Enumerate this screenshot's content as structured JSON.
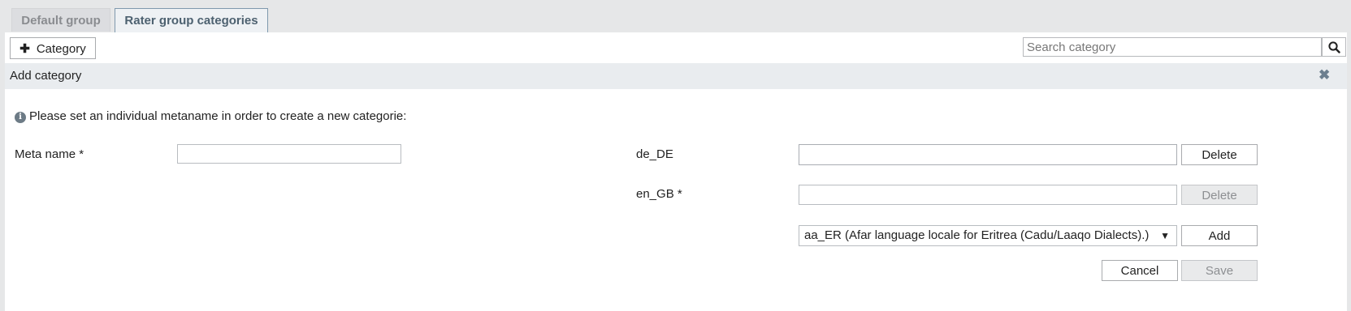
{
  "tabs": [
    {
      "label": "Default group"
    },
    {
      "label": "Rater group categories"
    }
  ],
  "toolbar": {
    "add_category_label": "Category",
    "search_placeholder": "Search category"
  },
  "form": {
    "title": "Add category",
    "info_text": "Please set an individual metaname in order to create a new categorie:",
    "meta_name_label": "Meta name *",
    "meta_name_value": "",
    "locales": [
      {
        "label": "de_DE",
        "value": "",
        "delete_label": "Delete"
      },
      {
        "label": "en_GB *",
        "value": "",
        "delete_label": "Delete"
      }
    ],
    "locale_select_value": "aa_ER (Afar language locale for Eritrea (Cadu/Laaqo Dialects).)",
    "add_label": "Add",
    "cancel_label": "Cancel",
    "save_label": "Save"
  }
}
